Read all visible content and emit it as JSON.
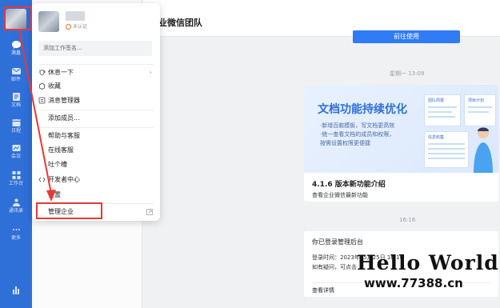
{
  "sidebar": {
    "items": [
      {
        "label": "消息",
        "icon": "message-icon"
      },
      {
        "label": "邮件",
        "icon": "mail-icon"
      },
      {
        "label": "文档",
        "icon": "doc-icon"
      },
      {
        "label": "日程",
        "icon": "calendar-icon"
      },
      {
        "label": "会议",
        "icon": "meeting-icon"
      },
      {
        "label": "工作台",
        "icon": "workbench-icon"
      },
      {
        "label": "通讯录",
        "icon": "contacts-icon"
      },
      {
        "label": "更多",
        "icon": "more-icon"
      }
    ]
  },
  "main": {
    "title": "业微信团队",
    "use_button": "前往使用",
    "timestamp1": "星期一 13:09",
    "banner_title": "文档功能持续优化",
    "banner_text_1": "·新增百款模板，写文档更高效",
    "banner_text_2": "·统一查看文档的成员和权限，",
    "banner_text_3": "按需设置权限更便捷",
    "mini_tags": [
      "团队周报",
      "项目计划",
      "信息收集"
    ],
    "card_heading": "4.1.6 版本新功能介绍",
    "card_sub": "查看企业微信最新功能",
    "timestamp2": "16:16",
    "admin_title": "你已登录管理后台",
    "admin_line1": "登录时间：2023年05月25日 16:16",
    "admin_line2": "如有疑问，可点击",
    "admin_link": "查看详情"
  },
  "popup": {
    "status": "未认证",
    "signature_placeholder": "添加工作签名...",
    "items": [
      {
        "label": "休息一下",
        "icon": "rest-icon",
        "arrow": "›"
      },
      {
        "label": "收藏",
        "icon": "collect-icon"
      },
      {
        "label": "消息管理器",
        "icon": "message-manager-icon"
      },
      {
        "label": "添加成员..."
      },
      {
        "label": "帮助与客服"
      },
      {
        "label": "在线客服"
      },
      {
        "label": "吐个槽"
      },
      {
        "label": "开发者中心",
        "icon": "code-icon"
      },
      {
        "label": "设置"
      },
      {
        "label": "管理企业",
        "icon": "external-link-icon"
      }
    ]
  },
  "watermark": {
    "line1": "Hello World",
    "line2": "www.77388.cn"
  },
  "colors": {
    "sidebar": "#2f6fd8",
    "accent": "#2f7cf6",
    "highlight": "#e53935"
  }
}
